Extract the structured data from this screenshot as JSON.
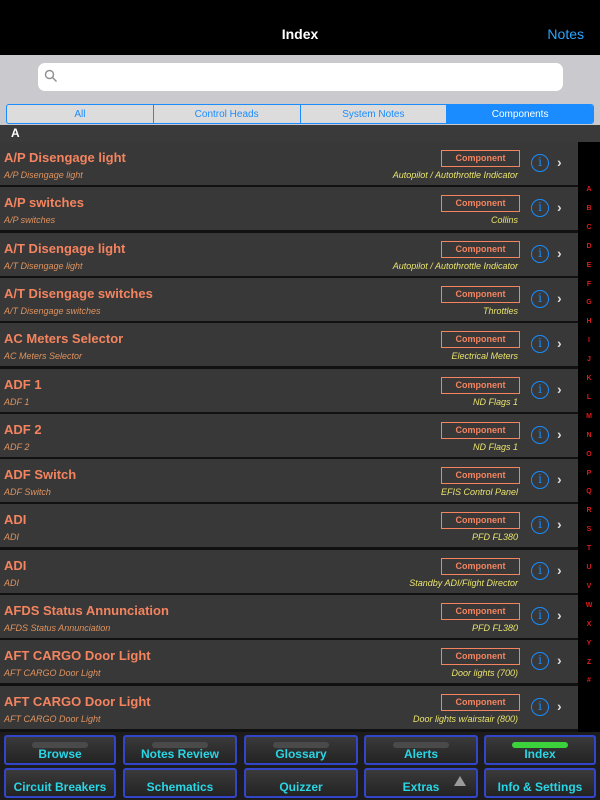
{
  "nav": {
    "title": "Index",
    "notes_label": "Notes"
  },
  "search": {
    "placeholder": ""
  },
  "segments": [
    {
      "label": "All",
      "active": false
    },
    {
      "label": "Control Heads",
      "active": false
    },
    {
      "label": "System Notes",
      "active": false
    },
    {
      "label": "Components",
      "active": true
    }
  ],
  "section": {
    "header": "A"
  },
  "rows": [
    {
      "name": "A/P Disengage light",
      "sub": "A/P Disengage light",
      "badge": "Component",
      "category": "Autopilot / Autothrottle Indicator"
    },
    {
      "name": "A/P switches",
      "sub": "A/P switches",
      "badge": "Component",
      "category": "Collins"
    },
    {
      "name": "A/T Disengage light",
      "sub": "A/T Disengage light",
      "badge": "Component",
      "category": "Autopilot / Autothrottle Indicator"
    },
    {
      "name": "A/T Disengage switches",
      "sub": "A/T Disengage switches",
      "badge": "Component",
      "category": "Throttles"
    },
    {
      "name": "AC Meters Selector",
      "sub": "AC Meters Selector",
      "badge": "Component",
      "category": "Electrical Meters"
    },
    {
      "name": "ADF 1",
      "sub": "ADF 1",
      "badge": "Component",
      "category": "ND Flags 1"
    },
    {
      "name": "ADF 2",
      "sub": "ADF 2",
      "badge": "Component",
      "category": "ND Flags 1"
    },
    {
      "name": "ADF Switch",
      "sub": "ADF Switch",
      "badge": "Component",
      "category": "EFIS Control Panel"
    },
    {
      "name": "ADI",
      "sub": "ADI",
      "badge": "Component",
      "category": "PFD FL380"
    },
    {
      "name": "ADI",
      "sub": "ADI",
      "badge": "Component",
      "category": "Standby ADI/Flight Director"
    },
    {
      "name": "AFDS Status Annunciation",
      "sub": "AFDS Status Annunciation",
      "badge": "Component",
      "category": "PFD FL380"
    },
    {
      "name": "AFT CARGO Door Light",
      "sub": "AFT CARGO Door Light",
      "badge": "Component",
      "category": "Door lights (700)"
    },
    {
      "name": "AFT CARGO Door Light",
      "sub": "AFT CARGO Door Light",
      "badge": "Component",
      "category": "Door lights w/airstair (800)"
    }
  ],
  "index_letters": [
    "A",
    "B",
    "C",
    "D",
    "E",
    "F",
    "G",
    "H",
    "I",
    "J",
    "K",
    "L",
    "M",
    "N",
    "O",
    "P",
    "Q",
    "R",
    "S",
    "T",
    "U",
    "V",
    "W",
    "X",
    "Y",
    "Z",
    "#"
  ],
  "tabs_row1": [
    {
      "label": "Browse",
      "active": false
    },
    {
      "label": "Notes Review",
      "active": false
    },
    {
      "label": "Glossary",
      "active": false
    },
    {
      "label": "Alerts",
      "active": false
    },
    {
      "label": "Index",
      "active": true
    }
  ],
  "tabs_row2": [
    {
      "label": "Circuit Breakers"
    },
    {
      "label": "Schematics"
    },
    {
      "label": "Quizzer"
    },
    {
      "label": "Extras"
    },
    {
      "label": "Info & Settings"
    }
  ],
  "colors": {
    "accent_blue": "#1a8cff",
    "item_title": "#f4845f",
    "category_yellow": "#e9e36d",
    "index_red": "#e01b1b",
    "tab_label_cyan": "#29d6e6",
    "active_indicator": "#3cd23c"
  }
}
